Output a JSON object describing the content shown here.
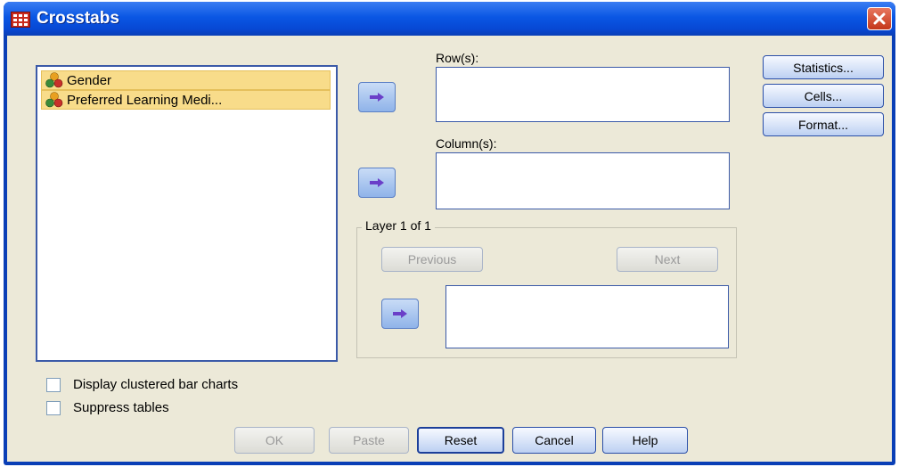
{
  "window": {
    "title": "Crosstabs"
  },
  "variables": [
    {
      "label": "Gender",
      "icon": "nominal-variable-icon"
    },
    {
      "label": "Preferred Learning Medi...",
      "icon": "nominal-variable-icon"
    }
  ],
  "rows": {
    "label": "Row(s):"
  },
  "columns": {
    "label": "Column(s):"
  },
  "layer": {
    "label": "Layer 1 of 1",
    "previous": "Previous",
    "next": "Next"
  },
  "side_buttons": {
    "statistics": "Statistics...",
    "cells": "Cells...",
    "format": "Format..."
  },
  "options": {
    "clustered": "Display clustered bar charts",
    "suppress": "Suppress tables"
  },
  "footer": {
    "ok": "OK",
    "paste": "Paste",
    "reset": "Reset",
    "cancel": "Cancel",
    "help": "Help"
  },
  "colors": {
    "title_bar": "#0a57e4",
    "dialog_bg": "#ece9d8",
    "selection": "#f8dc8a",
    "close_button": "#d0462a"
  }
}
